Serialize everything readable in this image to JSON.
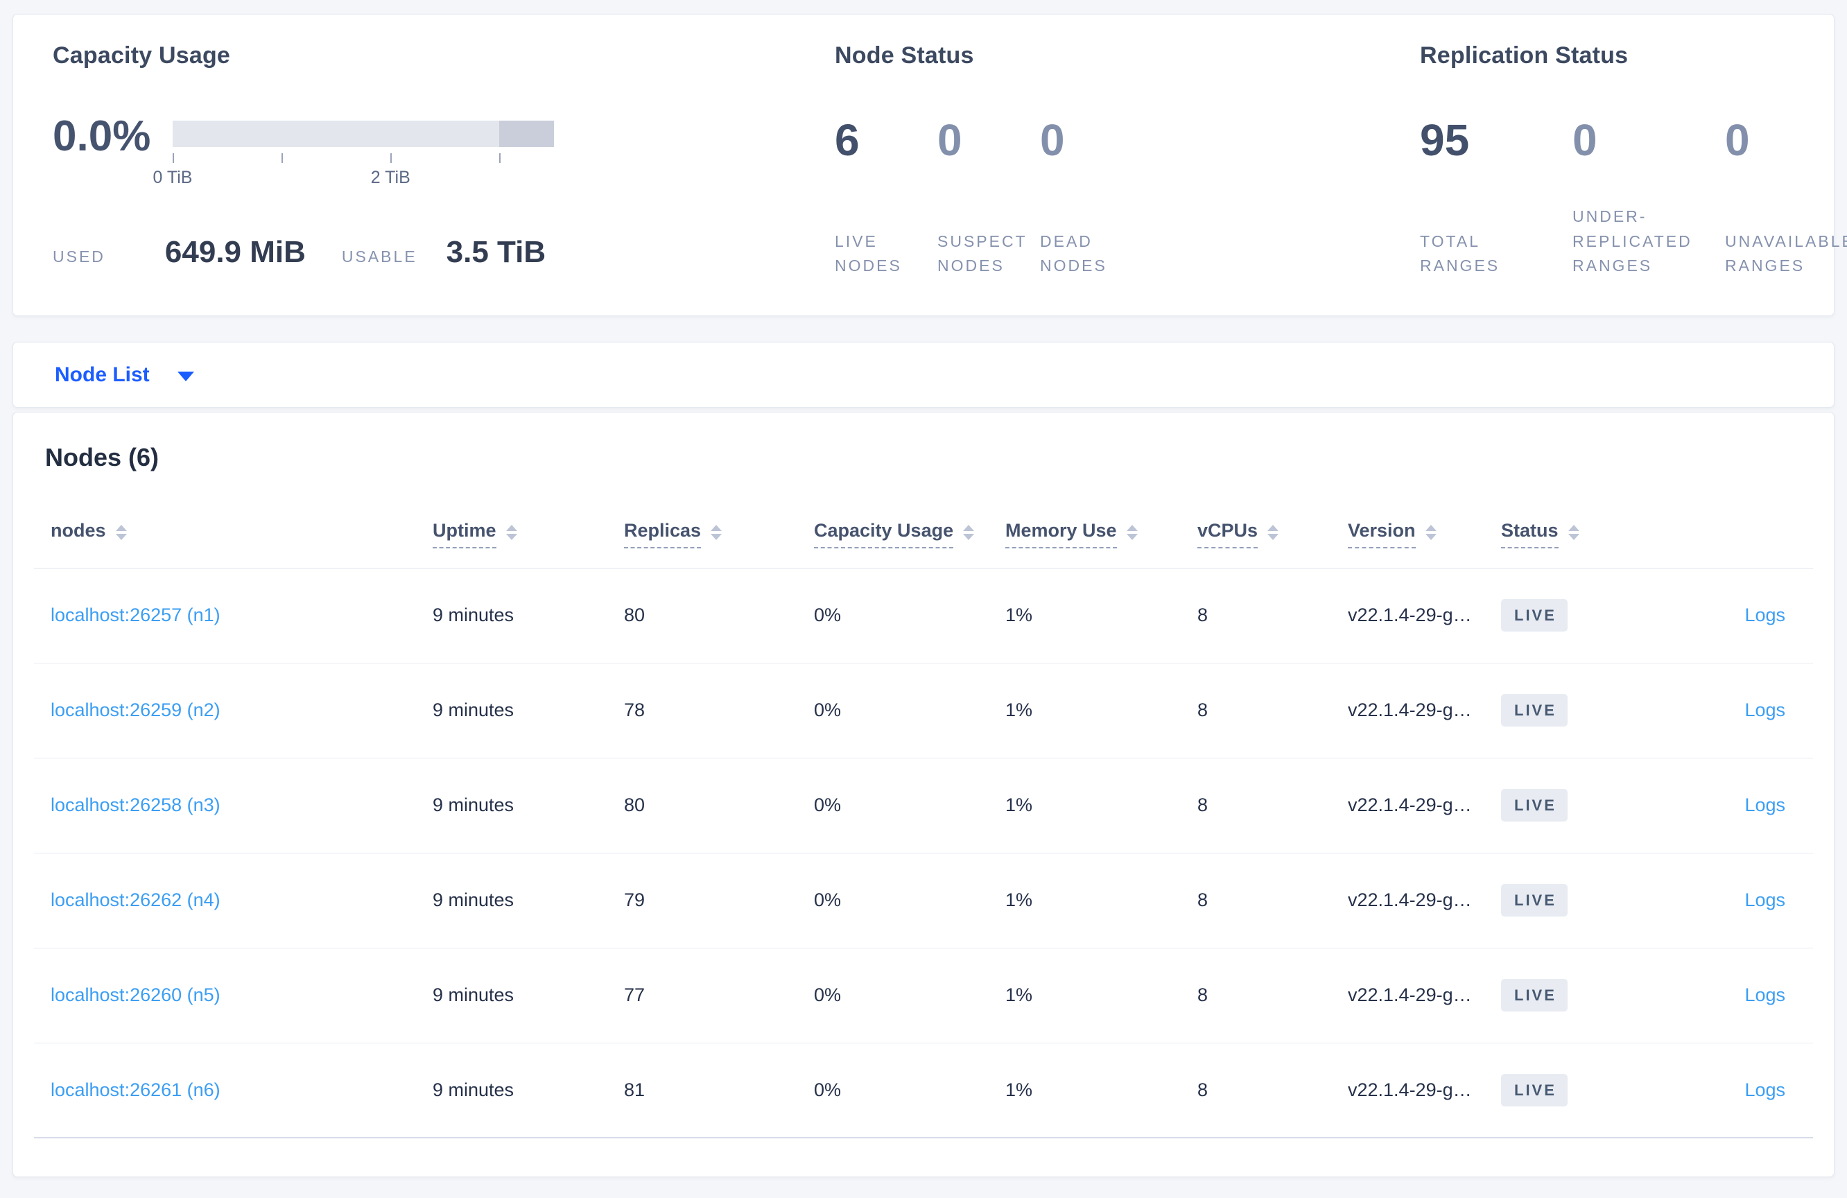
{
  "capacity": {
    "title": "Capacity Usage",
    "percent": "0.0%",
    "tick_label_0": "0 TiB",
    "tick_label_2": "2 TiB",
    "used_label": "USED",
    "used_value": "649.9 MiB",
    "usable_label": "USABLE",
    "usable_value": "3.5 TiB"
  },
  "node_status": {
    "title": "Node Status",
    "stats": [
      {
        "value": "6",
        "label": "LIVE\nNODES"
      },
      {
        "value": "0",
        "label": "SUSPECT\nNODES"
      },
      {
        "value": "0",
        "label": "DEAD\nNODES"
      }
    ]
  },
  "replication_status": {
    "title": "Replication Status",
    "stats": [
      {
        "value": "95",
        "label": "TOTAL\nRANGES"
      },
      {
        "value": "0",
        "label": "UNDER-\nREPLICATED\nRANGES"
      },
      {
        "value": "0",
        "label": "UNAVAILABLE\nRANGES"
      }
    ]
  },
  "view_selector": {
    "label": "Node List"
  },
  "nodes_table": {
    "title": "Nodes (6)",
    "columns": {
      "nodes": "nodes",
      "uptime": "Uptime",
      "replicas": "Replicas",
      "capacity_usage": "Capacity Usage",
      "memory_use": "Memory Use",
      "vcpus": "vCPUs",
      "version": "Version",
      "status": "Status"
    },
    "rows": [
      {
        "node": "localhost:26257 (n1)",
        "uptime": "9 minutes",
        "replicas": "80",
        "capacity_usage": "0%",
        "memory_use": "1%",
        "vcpus": "8",
        "version": "v22.1.4-29-g…",
        "status": "LIVE",
        "logs": "Logs"
      },
      {
        "node": "localhost:26259 (n2)",
        "uptime": "9 minutes",
        "replicas": "78",
        "capacity_usage": "0%",
        "memory_use": "1%",
        "vcpus": "8",
        "version": "v22.1.4-29-g…",
        "status": "LIVE",
        "logs": "Logs"
      },
      {
        "node": "localhost:26258 (n3)",
        "uptime": "9 minutes",
        "replicas": "80",
        "capacity_usage": "0%",
        "memory_use": "1%",
        "vcpus": "8",
        "version": "v22.1.4-29-g…",
        "status": "LIVE",
        "logs": "Logs"
      },
      {
        "node": "localhost:26262 (n4)",
        "uptime": "9 minutes",
        "replicas": "79",
        "capacity_usage": "0%",
        "memory_use": "1%",
        "vcpus": "8",
        "version": "v22.1.4-29-g…",
        "status": "LIVE",
        "logs": "Logs"
      },
      {
        "node": "localhost:26260 (n5)",
        "uptime": "9 minutes",
        "replicas": "77",
        "capacity_usage": "0%",
        "memory_use": "1%",
        "vcpus": "8",
        "version": "v22.1.4-29-g…",
        "status": "LIVE",
        "logs": "Logs"
      },
      {
        "node": "localhost:26261 (n6)",
        "uptime": "9 minutes",
        "replicas": "81",
        "capacity_usage": "0%",
        "memory_use": "1%",
        "vcpus": "8",
        "version": "v22.1.4-29-g…",
        "status": "LIVE",
        "logs": "Logs"
      }
    ]
  },
  "colors": {
    "accent_blue": "#1b5dff",
    "link_blue": "#3b9ef3",
    "bar_light": "#e3e6ec",
    "bar_dark": "#c9ceda",
    "badge_bg": "#e8ecf2"
  }
}
